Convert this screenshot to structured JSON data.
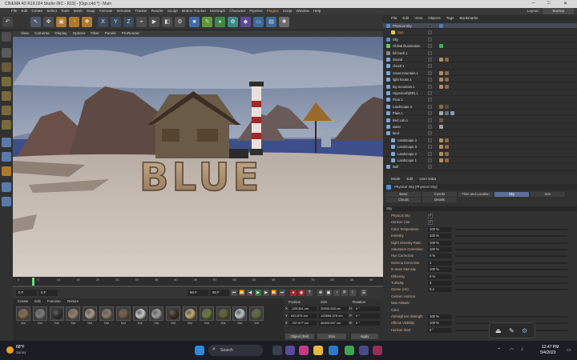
{
  "window": {
    "title": "CINEMA 4D R19.024 Studio (RC - R19) - [Ogo.c4d *] - Main"
  },
  "menubar": {
    "items": [
      "File",
      "Edit",
      "Create",
      "Select",
      "Tools",
      "Mesh",
      "Snap",
      "Animate",
      "Simulate",
      "Tracker",
      "Render",
      "Sculpt",
      "Motion Tracker",
      "MoGraph",
      "Character",
      "Pipeline",
      "Plugins",
      "Script",
      "Window",
      "Help"
    ],
    "highlight_index": 16,
    "layout_label": "Layout:",
    "layout_value": "Startup"
  },
  "viewport_menu": [
    "View",
    "Cameras",
    "Display",
    "Options",
    "Filter",
    "Panels",
    "ProRender"
  ],
  "viewport": {
    "scene_text": "BLUE"
  },
  "timeline": {
    "ticks": [
      "0",
      "5",
      "10",
      "15",
      "20",
      "25",
      "30",
      "35",
      "40",
      "45",
      "50",
      "55",
      "60",
      "65",
      "70",
      "75",
      "80",
      "85",
      "90"
    ],
    "frame_start": "0 F",
    "current_frame": "0 F",
    "frame_end": "90 F",
    "frame_end2": "90 F"
  },
  "materials": {
    "tabs": [
      "Create",
      "Edit",
      "Function",
      "Texture"
    ],
    "items": [
      {
        "label": "Mat",
        "color": "#8a6a4a"
      },
      {
        "label": "Mat",
        "color": "#7a7a7a"
      },
      {
        "label": "Mat",
        "color": "#2e2e2e"
      },
      {
        "label": "Mat",
        "color": "#9b7f6a"
      },
      {
        "label": "Mat",
        "color": "#a79a8a"
      },
      {
        "label": "Mat",
        "color": "#8c7a66"
      },
      {
        "label": "Mat",
        "color": "#6e5a44"
      },
      {
        "label": "Mat",
        "color": "#c9c9c9"
      },
      {
        "label": "Mat",
        "color": "#a0a0a0"
      },
      {
        "label": "Mat",
        "color": "#3b2d22"
      },
      {
        "label": "Mat",
        "color": "#c5a56a"
      },
      {
        "label": "Mat",
        "color": "#6b7a3a"
      },
      {
        "label": "Mat",
        "color": "#5e5c2e"
      },
      {
        "label": "Mat",
        "color": "#b9c4c9"
      },
      {
        "label": "Mat",
        "color": "#5a6a3a"
      }
    ]
  },
  "coords": {
    "col_position": "Position",
    "col_size": "Size",
    "col_rotation": "Rotation",
    "pos": [
      "-226.361 cm",
      "643.875 cm",
      "-787.577 cm"
    ],
    "size": [
      "20000.003 cm",
      "122608.378 cm",
      "46403.057 cm"
    ],
    "rot": [
      "0 °",
      "0 °",
      "0 °"
    ],
    "axis": [
      "X",
      "Y",
      "Z"
    ],
    "axis_r": [
      "H",
      "P",
      "B"
    ],
    "mode_obj": "Object (Rel)",
    "mode_size": "Size",
    "apply": "Apply"
  },
  "objects": {
    "menu": [
      "File",
      "Edit",
      "View",
      "Objects",
      "Tags",
      "Bookmarks"
    ],
    "rows": [
      {
        "name": "Physical Sky",
        "indent": 0,
        "icon": "#4d8fd6",
        "tags": [
          "#4a7ec4"
        ],
        "selected": true
      },
      {
        "name": "Sun",
        "indent": 1,
        "icon": "#e0c34a",
        "tags": [],
        "orange": true
      },
      {
        "name": "Sky",
        "indent": 0,
        "icon": "#4d8fd6",
        "tags": []
      },
      {
        "name": "Global Illumination",
        "indent": 0,
        "icon": "#6ac26a",
        "tags": [
          "#3fb24a"
        ]
      },
      {
        "name": "hill back.1",
        "indent": 0,
        "icon": "#8a8a8a",
        "tags": []
      },
      {
        "name": "Sound",
        "indent": 0,
        "icon": "#7aa6d8",
        "tags": [
          "#b58c5a",
          "#8a6a4a",
          "#2e2e2e"
        ]
      },
      {
        "name": "check 1",
        "indent": 0,
        "icon": "#7aa6d8",
        "tags": []
      },
      {
        "name": "coast mountain.1",
        "indent": 0,
        "icon": "#7aa6d8",
        "tags": [
          "#b58c5a",
          "#8a6a4a",
          "#2e2e2e"
        ]
      },
      {
        "name": "light house.1",
        "indent": 0,
        "icon": "#7aa6d8",
        "tags": [
          "#b58c5a",
          "#8a6a4a",
          "#2e2e2e"
        ]
      },
      {
        "name": "big mountain.1",
        "indent": 0,
        "icon": "#7aa6d8",
        "tags": [
          "#b58c5a",
          "#8a6a4a",
          "#2e2e2e"
        ]
      },
      {
        "name": "Hypernurb(BR).1",
        "indent": 0,
        "icon": "#7aa6d8",
        "tags": []
      },
      {
        "name": "Floor.1",
        "indent": 0,
        "icon": "#7aa6d8",
        "tags": []
      },
      {
        "name": "Landscape.3",
        "indent": 0,
        "icon": "#7aa6d8",
        "tags": [
          "#8a6a4a",
          "#5a4a3a"
        ]
      },
      {
        "name": "Plain.1",
        "indent": 0,
        "icon": "#7aa6d8",
        "tags": [
          "#a8a8a8",
          "#5a7a8a",
          "#8a9ab0"
        ]
      },
      {
        "name": "Bed Lab.1",
        "indent": 0,
        "icon": "#7aa6d8",
        "tags": [
          "#6a5a4a"
        ]
      },
      {
        "name": "water",
        "indent": 0,
        "icon": "#7aa6d8",
        "tags": [
          "#a0a0a0"
        ]
      },
      {
        "name": "land",
        "indent": 0,
        "icon": "#7aa6d8",
        "tags": []
      },
      {
        "name": "Landscape.4",
        "indent": 1,
        "icon": "#7aa6d8",
        "tags": [
          "#b58c5a",
          "#8a6a4a"
        ]
      },
      {
        "name": "Landscape.3",
        "indent": 1,
        "icon": "#7aa6d8",
        "tags": [
          "#b58c5a",
          "#8a6a4a"
        ]
      },
      {
        "name": "Landscape.2",
        "indent": 1,
        "icon": "#7aa6d8",
        "tags": [
          "#b58c5a",
          "#8a6a4a"
        ]
      },
      {
        "name": "Landscape.1",
        "indent": 1,
        "icon": "#7aa6d8",
        "tags": [
          "#b58c5a",
          "#8a6a4a"
        ]
      },
      {
        "name": "Null",
        "indent": 0,
        "icon": "#7aa6d8",
        "tags": []
      }
    ]
  },
  "attributes": {
    "menu": [
      "Mode",
      "Edit",
      "User Data"
    ],
    "object_title": "Physical Sky [Physical Sky]",
    "tabs_row1": [
      "Basic",
      "Coords",
      "Time and Location",
      "Sky",
      "Sun"
    ],
    "tabs_row2": [
      "Clouds",
      "Details"
    ],
    "active_tab": "Sky",
    "section": "Sky",
    "props": [
      {
        "label": "Physical Sky",
        "type": "check",
        "value": "✓"
      },
      {
        "label": "Horizon Line",
        "type": "check",
        "value": "✓"
      },
      {
        "label": "Color Temperature",
        "type": "val",
        "value": "100 %"
      },
      {
        "label": "Intensity",
        "type": "val",
        "value": "100 %"
      },
      {
        "label": "Night Intensity Ratio",
        "type": "val",
        "value": "100 %"
      },
      {
        "label": "Saturation Correction",
        "type": "val",
        "value": "100 %"
      },
      {
        "label": "Hue Correction",
        "type": "val",
        "value": "0 %"
      },
      {
        "label": "Gamma Correction",
        "type": "val",
        "value": "1"
      },
      {
        "label": "Is Seen Intensity",
        "type": "val",
        "value": "100 %"
      },
      {
        "label": "Dithering",
        "type": "val",
        "value": "0 %"
      },
      {
        "label": "Turbidity",
        "type": "val",
        "value": "3"
      },
      {
        "label": "Ozone (cm)",
        "type": "val",
        "value": "0.4"
      },
      {
        "label": "Custom Horizon",
        "type": "none",
        "value": ""
      },
      {
        "label": "Max Altitude",
        "type": "none",
        "value": ""
      },
      {
        "label": "Color",
        "type": "none",
        "value": ""
      },
      {
        "label": "Atmosphere Strength",
        "type": "val",
        "value": "100 %"
      },
      {
        "label": "Affects Visibility",
        "type": "val",
        "value": "100 %"
      },
      {
        "label": "Horizon Start",
        "type": "val",
        "value": "0 °"
      }
    ]
  },
  "taskbar": {
    "weather_temp": "68°F",
    "weather_desc": "Sunny",
    "search_placeholder": "Search",
    "time": "12:47 PM",
    "date": "5/4/2023"
  }
}
